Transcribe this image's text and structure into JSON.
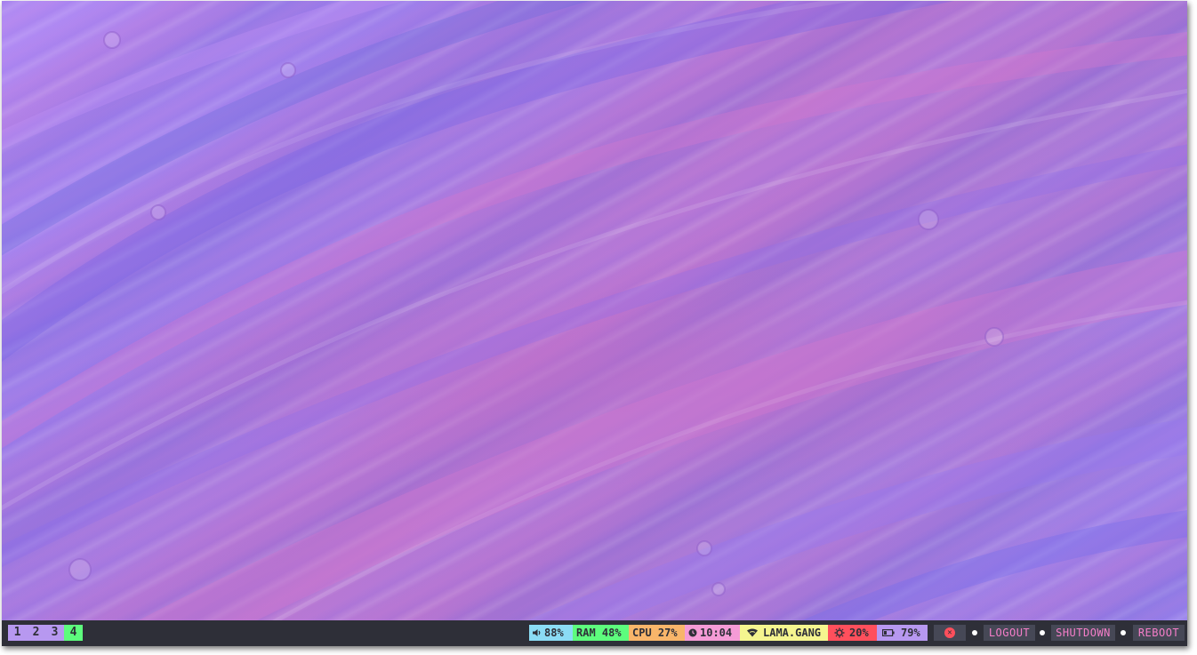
{
  "workspaces": [
    "1",
    "2",
    "3",
    "4"
  ],
  "active_workspace": "4",
  "status": {
    "volume": "88%",
    "ram": "RAM 48%",
    "cpu": "CPU 27%",
    "clock": "10:04",
    "network": "LAMA.GANG",
    "brightness": "20%",
    "battery": "79%"
  },
  "power": {
    "logout": "LOGOUT",
    "shutdown": "SHUTDOWN",
    "reboot": "REBOOT",
    "close_glyph": "✕"
  },
  "colors": {
    "bar_bg": "#2e2f38",
    "workspace_active": "#5dfc7d",
    "workspace_inactive": "#b798f0",
    "volume": "#8bdcf5",
    "ram": "#5dfc7d",
    "cpu": "#f8b56a",
    "clock": "#f59bd6",
    "network": "#f5f58f",
    "brightness": "#ff4f5c",
    "battery": "#b798f0",
    "power_text": "#f57ec9"
  },
  "icons": [
    "volume-icon",
    "clock-icon",
    "wifi-icon",
    "brightness-icon",
    "battery-icon",
    "close-icon"
  ]
}
